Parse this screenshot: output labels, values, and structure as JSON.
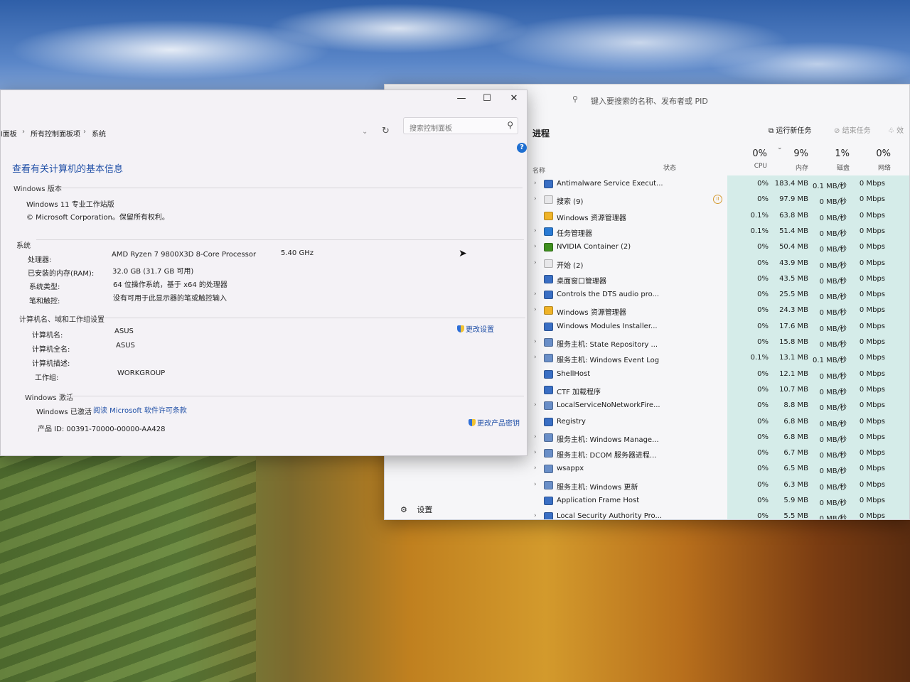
{
  "control_panel": {
    "breadcrumb": [
      "l面板",
      "所有控制面板项",
      "系统"
    ],
    "search_placeholder": "搜索控制面板",
    "heading": "查看有关计算机的基本信息",
    "edition": {
      "section": "Windows 版本",
      "name": "Windows 11 专业工作站版",
      "copyright": "© Microsoft Corporation。保留所有权利。"
    },
    "system": {
      "section": "系统",
      "processor_label": "处理器:",
      "processor_value": "AMD Ryzen 7 9800X3D 8-Core Processor",
      "processor_speed": "5.40 GHz",
      "ram_label": "已安装的内存(RAM):",
      "ram_value": "32.0 GB (31.7 GB 可用)",
      "type_label": "系统类型:",
      "type_value": "64 位操作系统，基于 x64 的处理器",
      "pen_label": "笔和触控:",
      "pen_value": "没有可用于此显示器的笔或触控输入"
    },
    "computer": {
      "section": "计算机名、域和工作组设置",
      "change_settings": "更改设置",
      "name_label": "计算机名:",
      "name_value": "ASUS",
      "fullname_label": "计算机全名:",
      "fullname_value": "ASUS",
      "desc_label": "计算机描述:",
      "workgroup_label": "工作组:",
      "workgroup_value": "WORKGROUP"
    },
    "activation": {
      "section": "Windows 激活",
      "status": "Windows 已激活",
      "license_link": "阅读 Microsoft 软件许可条款",
      "product_id": "产品 ID: 00391-70000-00000-AA428",
      "change_key": "更改产品密钥"
    }
  },
  "task_manager": {
    "search_placeholder": "键入要搜索的名称、发布者或 PID",
    "title": "进程",
    "run_new_task": "运行新任务",
    "end_task": "结束任务",
    "efficiency": "效",
    "columns": {
      "name": "名称",
      "status": "状态",
      "cpu_pct": "0%",
      "cpu": "CPU",
      "mem_pct": "9%",
      "mem": "内存",
      "disk_pct": "1%",
      "disk": "磁盘",
      "net_pct": "0%",
      "net": "网络"
    },
    "processes": [
      {
        "name": "Antimalware Service Execut...",
        "cpu": "0%",
        "mem": "183.4 MB",
        "disk": "0.1 MB/秒",
        "net": "0 Mbps",
        "expand": true,
        "icon": "#3a6fc4"
      },
      {
        "name": "搜索 (9)",
        "cpu": "0%",
        "mem": "97.9 MB",
        "disk": "0 MB/秒",
        "net": "0 Mbps",
        "expand": true,
        "icon": "#e8e8ea",
        "paused": true
      },
      {
        "name": "Windows 资源管理器",
        "cpu": "0.1%",
        "mem": "63.8 MB",
        "disk": "0 MB/秒",
        "net": "0 Mbps",
        "expand": false,
        "icon": "#f0b429"
      },
      {
        "name": "任务管理器",
        "cpu": "0.1%",
        "mem": "51.4 MB",
        "disk": "0 MB/秒",
        "net": "0 Mbps",
        "expand": true,
        "icon": "#2a7bd4"
      },
      {
        "name": "NVIDIA Container (2)",
        "cpu": "0%",
        "mem": "50.4 MB",
        "disk": "0 MB/秒",
        "net": "0 Mbps",
        "expand": true,
        "icon": "#3f8f1f"
      },
      {
        "name": "开始 (2)",
        "cpu": "0%",
        "mem": "43.9 MB",
        "disk": "0 MB/秒",
        "net": "0 Mbps",
        "expand": true,
        "icon": "#e8e8ea"
      },
      {
        "name": "桌面窗口管理器",
        "cpu": "0%",
        "mem": "43.5 MB",
        "disk": "0 MB/秒",
        "net": "0 Mbps",
        "expand": false,
        "icon": "#3a6fc4"
      },
      {
        "name": "Controls the DTS audio pro...",
        "cpu": "0%",
        "mem": "25.5 MB",
        "disk": "0 MB/秒",
        "net": "0 Mbps",
        "expand": true,
        "icon": "#3a6fc4"
      },
      {
        "name": "Windows 资源管理器",
        "cpu": "0%",
        "mem": "24.3 MB",
        "disk": "0 MB/秒",
        "net": "0 Mbps",
        "expand": true,
        "icon": "#f0b429"
      },
      {
        "name": "Windows Modules Installer...",
        "cpu": "0%",
        "mem": "17.6 MB",
        "disk": "0 MB/秒",
        "net": "0 Mbps",
        "expand": false,
        "icon": "#3a6fc4"
      },
      {
        "name": "服务主机: State Repository ...",
        "cpu": "0%",
        "mem": "15.8 MB",
        "disk": "0 MB/秒",
        "net": "0 Mbps",
        "expand": true,
        "icon": "#6a8fc8"
      },
      {
        "name": "服务主机: Windows Event Log",
        "cpu": "0.1%",
        "mem": "13.1 MB",
        "disk": "0.1 MB/秒",
        "net": "0 Mbps",
        "expand": true,
        "icon": "#6a8fc8"
      },
      {
        "name": "ShellHost",
        "cpu": "0%",
        "mem": "12.1 MB",
        "disk": "0 MB/秒",
        "net": "0 Mbps",
        "expand": false,
        "icon": "#3a6fc4"
      },
      {
        "name": "CTF 加载程序",
        "cpu": "0%",
        "mem": "10.7 MB",
        "disk": "0 MB/秒",
        "net": "0 Mbps",
        "expand": false,
        "icon": "#3a6fc4"
      },
      {
        "name": "LocalServiceNoNetworkFire...",
        "cpu": "0%",
        "mem": "8.8 MB",
        "disk": "0 MB/秒",
        "net": "0 Mbps",
        "expand": true,
        "icon": "#6a8fc8"
      },
      {
        "name": "Registry",
        "cpu": "0%",
        "mem": "6.8 MB",
        "disk": "0 MB/秒",
        "net": "0 Mbps",
        "expand": false,
        "icon": "#3a6fc4"
      },
      {
        "name": "服务主机: Windows Manage...",
        "cpu": "0%",
        "mem": "6.8 MB",
        "disk": "0 MB/秒",
        "net": "0 Mbps",
        "expand": true,
        "icon": "#6a8fc8"
      },
      {
        "name": "服务主机: DCOM 服务器进程...",
        "cpu": "0%",
        "mem": "6.7 MB",
        "disk": "0 MB/秒",
        "net": "0 Mbps",
        "expand": true,
        "icon": "#6a8fc8"
      },
      {
        "name": "wsappx",
        "cpu": "0%",
        "mem": "6.5 MB",
        "disk": "0 MB/秒",
        "net": "0 Mbps",
        "expand": true,
        "icon": "#6a8fc8"
      },
      {
        "name": "服务主机: Windows 更新",
        "cpu": "0%",
        "mem": "6.3 MB",
        "disk": "0 MB/秒",
        "net": "0 Mbps",
        "expand": true,
        "icon": "#6a8fc8"
      },
      {
        "name": "Application Frame Host",
        "cpu": "0%",
        "mem": "5.9 MB",
        "disk": "0 MB/秒",
        "net": "0 Mbps",
        "expand": false,
        "icon": "#3a6fc4"
      },
      {
        "name": "Local Security Authority Pro...",
        "cpu": "0%",
        "mem": "5.5 MB",
        "disk": "0 MB/秒",
        "net": "0 Mbps",
        "expand": true,
        "icon": "#3a6fc4"
      }
    ],
    "settings": "设置"
  }
}
